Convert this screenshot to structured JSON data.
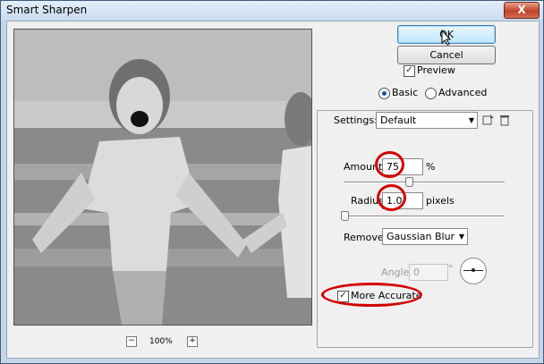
{
  "window": {
    "title": "Smart Sharpen",
    "close_label": "X"
  },
  "buttons": {
    "ok": "OK",
    "cancel": "Cancel"
  },
  "preview": {
    "label": "Preview",
    "checked": true,
    "zoom": "100%",
    "zoom_out": "−",
    "zoom_in": "+"
  },
  "mode": {
    "basic": "Basic",
    "advanced": "Advanced",
    "selected": "Basic"
  },
  "settings": {
    "label": "Settings:",
    "value": "Default"
  },
  "amount": {
    "label": "Amount:",
    "value": "75",
    "unit": "%",
    "fraction": 0.19
  },
  "radius": {
    "label": "Radius:",
    "value": "1.0",
    "unit": "pixels",
    "fraction": 0.0
  },
  "remove": {
    "label": "Remove:",
    "value": "Gaussian Blur"
  },
  "angle": {
    "label": "Angle:",
    "value": "0",
    "unit": "°"
  },
  "more_accurate": {
    "label": "More Accurate",
    "checked": true
  },
  "colors": {
    "annotation": "#d40000",
    "accent": "#3c7fb1"
  }
}
